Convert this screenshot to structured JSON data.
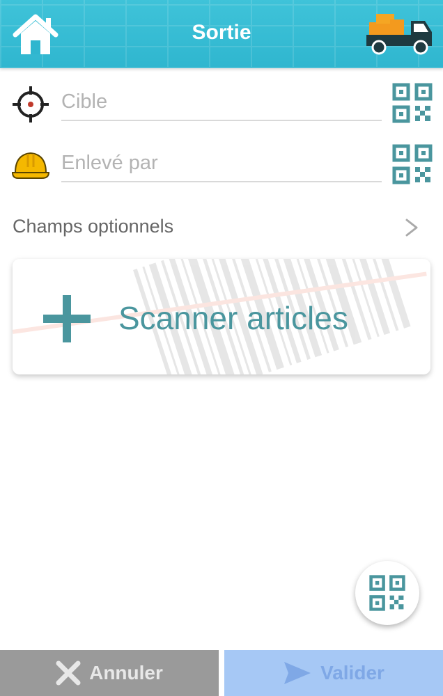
{
  "header": {
    "title": "Sortie",
    "home_icon": "home-icon",
    "truck_icon": "truck-icon"
  },
  "fields": [
    {
      "placeholder": "Cible",
      "value": "",
      "icon": "target-icon",
      "qr_icon": "qr-code-icon"
    },
    {
      "placeholder": "Enlevé par",
      "value": "",
      "icon": "hard-hat-icon",
      "qr_icon": "qr-code-icon"
    }
  ],
  "optional": {
    "label": "Champs optionnels",
    "icon": "chevron-right-icon"
  },
  "scan_card": {
    "label": "Scanner articles",
    "icon": "plus-icon"
  },
  "fab": {
    "icon": "qr-code-icon"
  },
  "footer": {
    "cancel_label": "Annuler",
    "validate_label": "Valider"
  },
  "colors": {
    "header": "#3fc3d9",
    "accent": "#4a969e",
    "cancel_bg": "#9a9a9a",
    "validate_bg": "#a6c8f5"
  }
}
